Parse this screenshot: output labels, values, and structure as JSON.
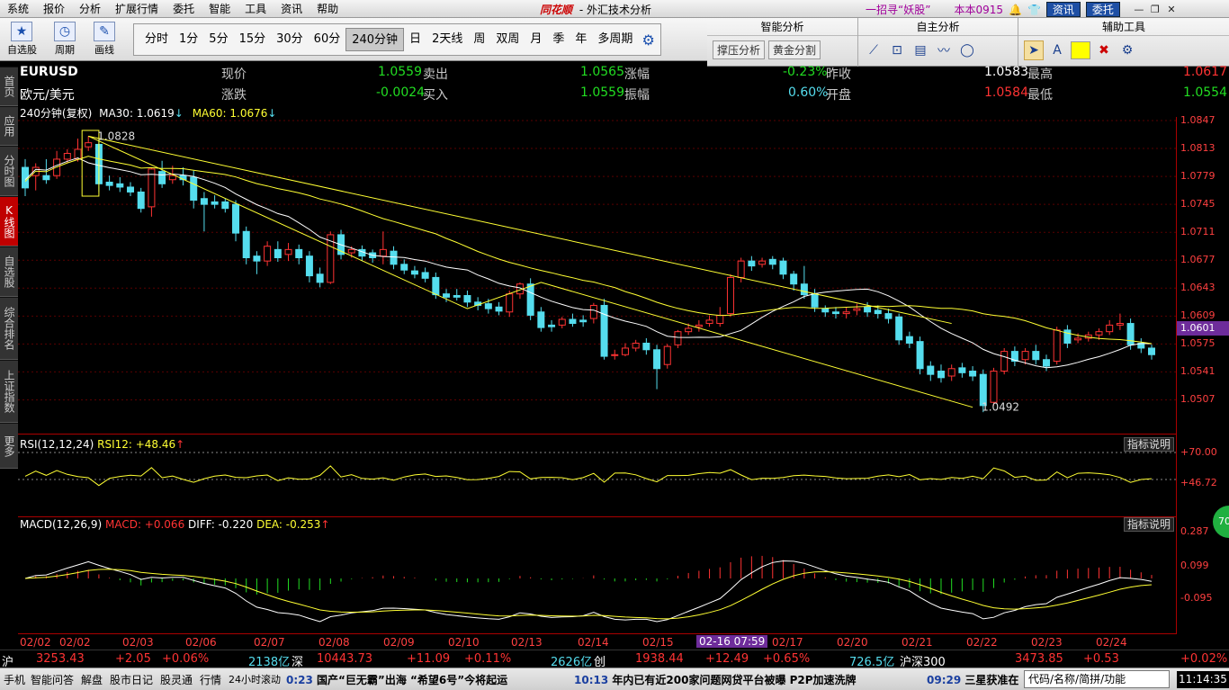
{
  "menu": {
    "items": [
      "系统",
      "报价",
      "分析",
      "扩展行情",
      "委托",
      "智能",
      "工具",
      "资讯",
      "帮助"
    ],
    "brand": "同花顺",
    "title": "- 外汇技术分析",
    "ad": "一招寻“妖股”",
    "version": "本本0915",
    "news_btn": "资讯",
    "trade_btn": "委托"
  },
  "toolbar": {
    "icons": [
      {
        "label": "自选股",
        "icon": "star-icon"
      },
      {
        "label": "周期",
        "icon": "clock-icon"
      },
      {
        "label": "画线",
        "icon": "pencil-icon"
      }
    ],
    "periods": [
      "分时",
      "1分",
      "5分",
      "15分",
      "30分",
      "60分",
      "240分钟",
      "日",
      "2天线",
      "周",
      "双周",
      "月",
      "季",
      "年",
      "多周期"
    ],
    "active_period": "240分钟"
  },
  "analysis": {
    "smart_title": "智能分析",
    "smart_btns": [
      "撑压分析",
      "黄金分割"
    ],
    "self_title": "自主分析",
    "aux_title": "辅助工具"
  },
  "left_tabs": [
    {
      "label": "首页",
      "active": false
    },
    {
      "label": "应用",
      "active": false
    },
    {
      "label": "分时图",
      "active": false
    },
    {
      "label": "K线图",
      "active": true
    },
    {
      "label": "自选股",
      "active": false
    },
    {
      "label": "综合排名",
      "active": false
    },
    {
      "label": "上证指数",
      "active": false
    },
    {
      "label": "更多",
      "active": false
    }
  ],
  "quote": {
    "symbol": "EURUSD",
    "name": "欧元/美元",
    "l_now": "现价",
    "now": "1.0559",
    "l_sell": "卖出",
    "sell": "1.0565",
    "l_pct": "涨幅",
    "pct": "-0.23%",
    "l_prev": "昨收",
    "prev": "1.0583",
    "l_high": "最高",
    "high": "1.0617",
    "l_chg": "涨跌",
    "chg": "-0.0024",
    "l_buy": "买入",
    "buy": "1.0559",
    "l_amp": "振幅",
    "amp": "0.60%",
    "l_open": "开盘",
    "open": "1.0584",
    "l_low": "最低",
    "low": "1.0554"
  },
  "ma": {
    "period": "240分钟(复权)",
    "ma30": "MA30: 1.0619",
    "ma60": "MA60: 1.0676",
    "arrow": "↓"
  },
  "price_axis": [
    "1.0847",
    "1.0813",
    "1.0779",
    "1.0745",
    "1.0711",
    "1.0677",
    "1.0643",
    "1.0609",
    "1.0575",
    "1.0541",
    "1.0507"
  ],
  "current_price": "1.0601",
  "high_label": "1.0828",
  "low_label": "1.0492",
  "rsi": {
    "title": "RSI(12,12,24)",
    "value": "RSI12: +48.46",
    "arrow": "↑",
    "ticks": [
      "+70.00",
      "+46.72"
    ],
    "help": "指标说明"
  },
  "macd": {
    "title": "MACD(12,26,9)",
    "macd": "MACD: +0.066",
    "diff": "DIFF: -0.220",
    "dea": "DEA: -0.253",
    "arrow": "↑",
    "ticks": [
      "0.287",
      "0.099",
      "-0.095"
    ],
    "help": "指标说明",
    "badge": "70"
  },
  "dates": [
    "02/02",
    "02/02",
    "02/03",
    "02/06",
    "02/07",
    "02/08",
    "02/09",
    "02/10",
    "02/13",
    "02/14",
    "02/15",
    "02/17",
    "02/20",
    "02/21",
    "02/22",
    "02/23",
    "02/24"
  ],
  "cursor_date": "02-16 07:59",
  "ticker": {
    "sh_label": "沪",
    "sh": "3253.43",
    "sh_chg": "+2.05",
    "sh_pct": "+0.06%",
    "sh_amt": "2138亿",
    "sz_label": "深",
    "sz": "10443.73",
    "sz_chg": "+11.09",
    "sz_pct": "+0.11%",
    "sz_amt": "2626亿",
    "cy_label": "创",
    "cy": "1938.44",
    "cy_chg": "+12.49",
    "cy_pct": "+0.65%",
    "cy_amt": "726.5亿",
    "hs_label": "沪深300",
    "hs": "3473.85",
    "hs_chg": "+0.53",
    "hs_pct": "+0.02%"
  },
  "status": {
    "items": [
      "手机",
      "智能问答",
      "解盘",
      "股市日记",
      "股灵通",
      "行情",
      "24小时滚动"
    ],
    "news1_time": "0:23",
    "news1": "国产“巨无霸”出海 “希望6号”今将起运",
    "news2_time": "10:13",
    "news2": "年内已有近200家问题网贷平台被曝 P2P加速洗牌",
    "news3_time": "09:29",
    "news3": "三星获准在",
    "search_placeholder": "代码/名称/简拼/功能",
    "clock": "11:14:35"
  },
  "chart_data": {
    "type": "candlestick",
    "symbol": "EURUSD",
    "interval": "240分钟",
    "ylim": [
      1.0492,
      1.0847
    ],
    "candles": [
      [
        1.079,
        1.08,
        1.0765,
        1.0755
      ],
      [
        1.078,
        1.0795,
        1.079,
        1.0762
      ],
      [
        1.078,
        1.08,
        1.0775,
        1.077
      ],
      [
        1.078,
        1.081,
        1.08,
        1.0776
      ],
      [
        1.08,
        1.0812,
        1.0807,
        1.0795
      ],
      [
        1.08,
        1.0825,
        1.0812,
        1.0797
      ],
      [
        1.0815,
        1.0828,
        1.082,
        1.081
      ],
      [
        1.0818,
        1.0822,
        1.077,
        1.076
      ],
      [
        1.0772,
        1.078,
        1.0768,
        1.0762
      ],
      [
        1.077,
        1.0778,
        1.0766,
        1.076
      ],
      [
        1.0766,
        1.0772,
        1.076,
        1.0755
      ],
      [
        1.076,
        1.0765,
        1.074,
        1.0735
      ],
      [
        1.0742,
        1.079,
        1.0788,
        1.073
      ],
      [
        1.0785,
        1.0798,
        1.077,
        1.0765
      ],
      [
        1.0775,
        1.0792,
        1.078,
        1.077
      ],
      [
        1.078,
        1.079,
        1.0775,
        1.0768
      ],
      [
        1.0778,
        1.0786,
        1.075,
        1.074
      ],
      [
        1.0752,
        1.076,
        1.0745,
        1.0712
      ],
      [
        1.0748,
        1.0756,
        1.0745,
        1.074
      ],
      [
        1.0748,
        1.0752,
        1.074,
        1.0735
      ],
      [
        1.0745,
        1.075,
        1.071,
        1.07
      ],
      [
        1.0712,
        1.0718,
        1.068,
        1.0672
      ],
      [
        1.0682,
        1.0688,
        1.0676,
        1.066
      ],
      [
        1.0676,
        1.07,
        1.0694,
        1.067
      ],
      [
        1.069,
        1.07,
        1.068,
        1.0675
      ],
      [
        1.0684,
        1.0698,
        1.069,
        1.0676
      ],
      [
        1.069,
        1.0696,
        1.068,
        1.0672
      ],
      [
        1.0682,
        1.0688,
        1.0658,
        1.065
      ],
      [
        1.066,
        1.0668,
        1.065,
        1.0644
      ],
      [
        1.065,
        1.0712,
        1.0708,
        1.0648
      ],
      [
        1.0708,
        1.0714,
        1.0684,
        1.0678
      ],
      [
        1.0686,
        1.0694,
        1.069,
        1.068
      ],
      [
        1.069,
        1.0695,
        1.0682,
        1.0676
      ],
      [
        1.0686,
        1.069,
        1.068,
        1.0674
      ],
      [
        1.0682,
        1.0712,
        1.069,
        1.0672
      ],
      [
        1.0688,
        1.0694,
        1.0672,
        1.0666
      ],
      [
        1.0672,
        1.0678,
        1.0665,
        1.066
      ],
      [
        1.0664,
        1.067,
        1.066,
        1.0655
      ],
      [
        1.0662,
        1.0668,
        1.0655,
        1.065
      ],
      [
        1.0656,
        1.0662,
        1.0635,
        1.063
      ],
      [
        1.0636,
        1.0642,
        1.0632,
        1.0626
      ],
      [
        1.0634,
        1.0642,
        1.0632,
        1.0628
      ],
      [
        1.0634,
        1.064,
        1.0626,
        1.062
      ],
      [
        1.0626,
        1.0632,
        1.0622,
        1.0616
      ],
      [
        1.0624,
        1.063,
        1.0618,
        1.0612
      ],
      [
        1.062,
        1.0626,
        1.0615,
        1.061
      ],
      [
        1.0614,
        1.064,
        1.0636,
        1.0608
      ],
      [
        1.0636,
        1.065,
        1.0648,
        1.063
      ],
      [
        1.0648,
        1.0655,
        1.061,
        1.0604
      ],
      [
        1.0614,
        1.062,
        1.0595,
        1.059
      ],
      [
        1.0598,
        1.0604,
        1.0596,
        1.059
      ],
      [
        1.0598,
        1.0608,
        1.0605,
        1.0594
      ],
      [
        1.0605,
        1.0612,
        1.06,
        1.0596
      ],
      [
        1.0604,
        1.061,
        1.0602,
        1.0596
      ],
      [
        1.0606,
        1.0625,
        1.0622,
        1.06
      ],
      [
        1.0622,
        1.063,
        1.056,
        1.0556
      ],
      [
        1.0562,
        1.0568,
        1.0562,
        1.0556
      ],
      [
        1.0562,
        1.0576,
        1.057,
        1.056
      ],
      [
        1.057,
        1.058,
        1.0576,
        1.0566
      ],
      [
        1.0576,
        1.0582,
        1.0568,
        1.0562
      ],
      [
        1.0568,
        1.0574,
        1.0545,
        1.052
      ],
      [
        1.055,
        1.0575,
        1.0572,
        1.0545
      ],
      [
        1.0574,
        1.0592,
        1.059,
        1.057
      ],
      [
        1.059,
        1.06,
        1.0594,
        1.0586
      ],
      [
        1.0596,
        1.0604,
        1.0598,
        1.059
      ],
      [
        1.06,
        1.061,
        1.0604,
        1.0596
      ],
      [
        1.06,
        1.062,
        1.061,
        1.0596
      ],
      [
        1.0612,
        1.066,
        1.0656,
        1.0608
      ],
      [
        1.0656,
        1.068,
        1.0676,
        1.065
      ],
      [
        1.0676,
        1.0682,
        1.067,
        1.0664
      ],
      [
        1.0672,
        1.068,
        1.0676,
        1.0668
      ],
      [
        1.0678,
        1.0682,
        1.0672,
        1.0666
      ],
      [
        1.0676,
        1.068,
        1.066,
        1.0654
      ],
      [
        1.066,
        1.0664,
        1.0648,
        1.064
      ],
      [
        1.0648,
        1.067,
        1.0635,
        1.063
      ],
      [
        1.0636,
        1.0642,
        1.062,
        1.0614
      ],
      [
        1.0618,
        1.0622,
        1.0614,
        1.0608
      ],
      [
        1.0614,
        1.062,
        1.0612,
        1.0606
      ],
      [
        1.0612,
        1.062,
        1.0614,
        1.0606
      ],
      [
        1.0616,
        1.0624,
        1.0618,
        1.061
      ],
      [
        1.062,
        1.0626,
        1.0614,
        1.0608
      ],
      [
        1.0616,
        1.0622,
        1.0612,
        1.0606
      ],
      [
        1.0612,
        1.0618,
        1.0606,
        1.06
      ],
      [
        1.0608,
        1.0612,
        1.058,
        1.0574
      ],
      [
        1.0584,
        1.059,
        1.0576,
        1.057
      ],
      [
        1.0578,
        1.0584,
        1.0545,
        1.0538
      ],
      [
        1.0548,
        1.0554,
        1.0538,
        1.053
      ],
      [
        1.0542,
        1.055,
        1.0534,
        1.0528
      ],
      [
        1.0536,
        1.055,
        1.0545,
        1.053
      ],
      [
        1.0546,
        1.0552,
        1.054,
        1.0534
      ],
      [
        1.0542,
        1.0548,
        1.0536,
        1.053
      ],
      [
        1.0538,
        1.0544,
        1.05,
        1.0492
      ],
      [
        1.0504,
        1.0546,
        1.0542,
        1.05
      ],
      [
        1.0542,
        1.057,
        1.0566,
        1.0538
      ],
      [
        1.0566,
        1.0572,
        1.0554,
        1.0548
      ],
      [
        1.0556,
        1.057,
        1.0566,
        1.055
      ],
      [
        1.0566,
        1.0574,
        1.0556,
        1.055
      ],
      [
        1.0556,
        1.0562,
        1.0548,
        1.0542
      ],
      [
        1.0554,
        1.0596,
        1.0592,
        1.055
      ],
      [
        1.0592,
        1.0598,
        1.0576,
        1.057
      ],
      [
        1.058,
        1.0588,
        1.0582,
        1.0576
      ],
      [
        1.0582,
        1.059,
        1.0586,
        1.0578
      ],
      [
        1.0586,
        1.0594,
        1.059,
        1.058
      ],
      [
        1.059,
        1.0604,
        1.0598,
        1.0586
      ],
      [
        1.0598,
        1.0612,
        1.06,
        1.0592
      ],
      [
        1.06,
        1.0606,
        1.0574,
        1.0568
      ],
      [
        1.0576,
        1.0582,
        1.057,
        1.0564
      ],
      [
        1.057,
        1.0574,
        1.0562,
        1.0556
      ]
    ]
  }
}
